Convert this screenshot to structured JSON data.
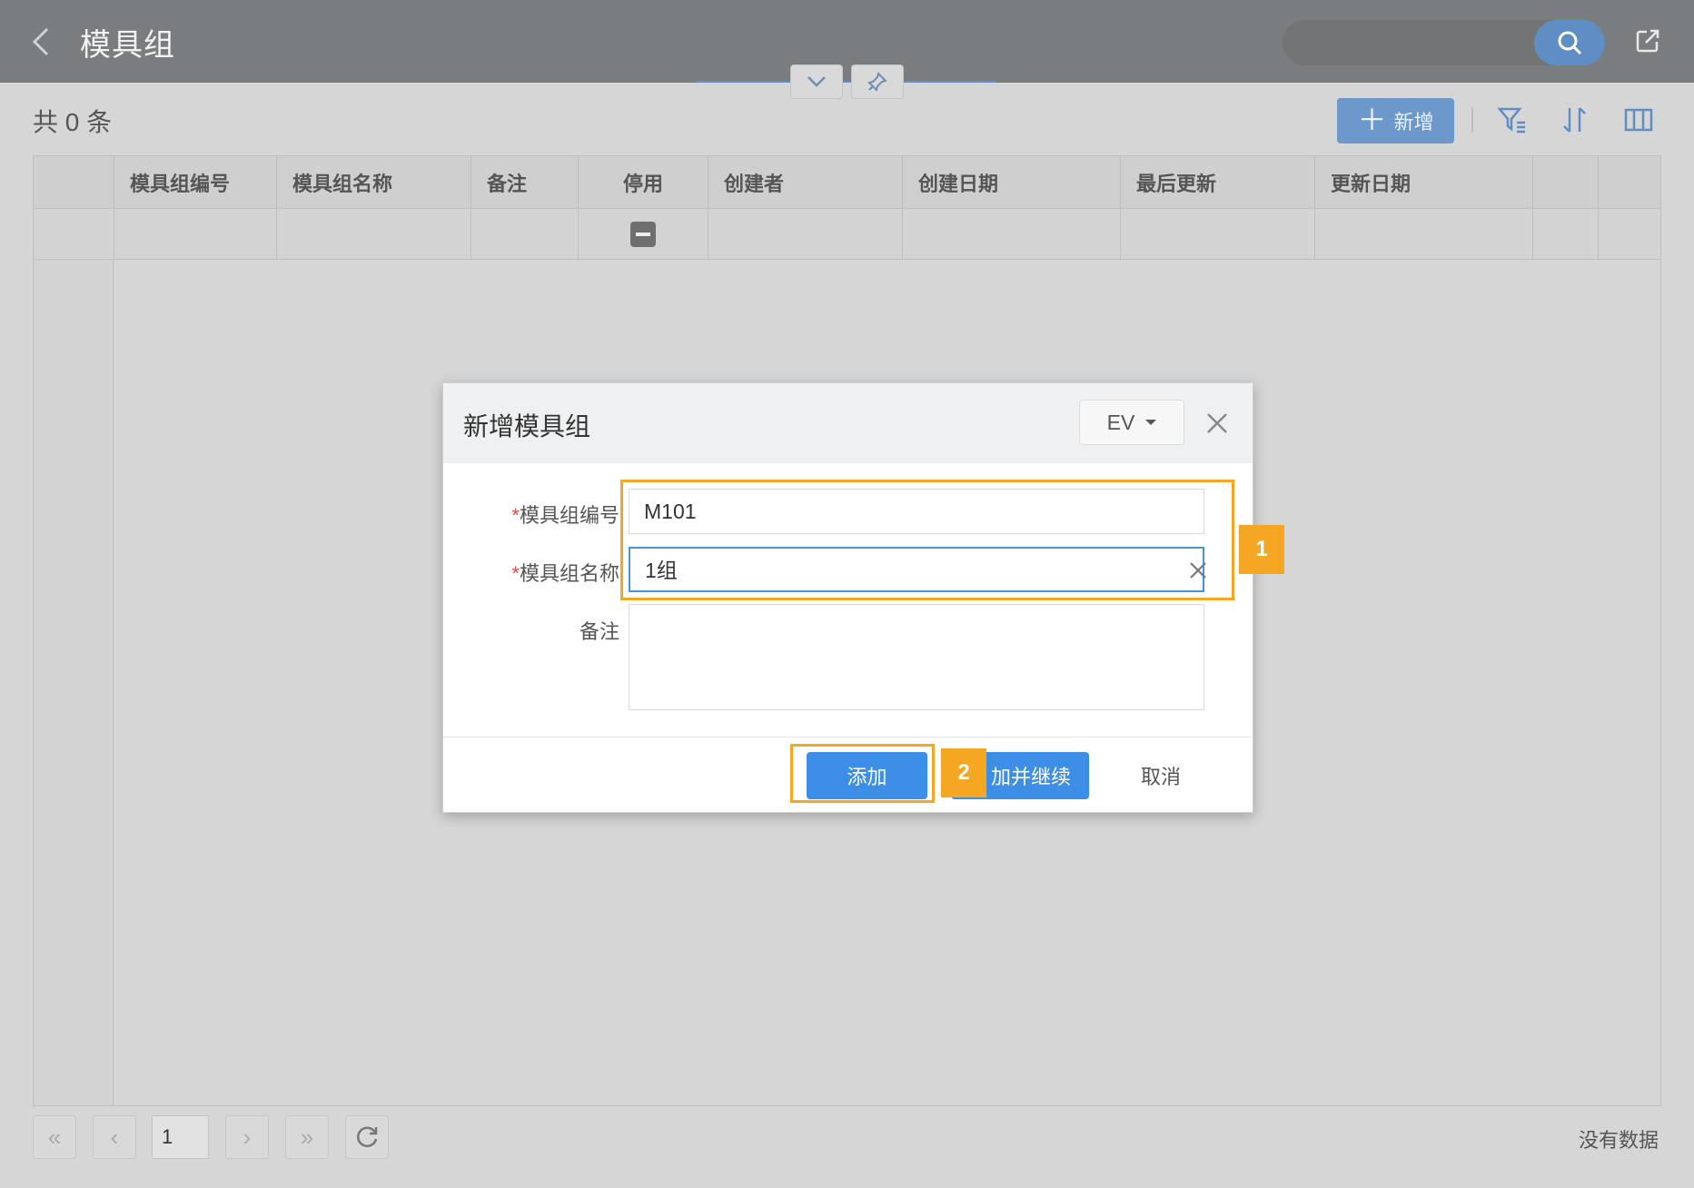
{
  "header": {
    "title": "模具组",
    "icons": {
      "back": "chevron-left-icon",
      "search": "search-icon",
      "share": "external-link-icon",
      "collapse": "chevron-down-icon",
      "pin": "pin-icon"
    }
  },
  "toolbar": {
    "count_text": "共 0 条",
    "add_label": "新增",
    "icons": {
      "filter": "filter-icon",
      "sort": "sort-icon",
      "columns": "columns-icon"
    }
  },
  "table": {
    "columns": [
      "模具组编号",
      "模具组名称",
      "备注",
      "停用",
      "创建者",
      "创建日期",
      "最后更新",
      "更新日期"
    ],
    "rows": []
  },
  "pager": {
    "page": "1",
    "status": "没有数据",
    "icons": {
      "first": "double-chevron-left-icon",
      "prev": "chevron-left-icon",
      "next": "chevron-right-icon",
      "last": "double-chevron-right-icon",
      "refresh": "refresh-icon"
    }
  },
  "dialog": {
    "title": "新增模具组",
    "language": "EV",
    "fields": {
      "code": {
        "required_mark": "*",
        "label": "模具组编号",
        "value": "M101"
      },
      "name": {
        "required_mark": "*",
        "label": "模具组名称",
        "value": "1组"
      },
      "remark": {
        "label": "备注",
        "value": ""
      }
    },
    "buttons": {
      "add": "添加",
      "add_continue": "加并继续",
      "cancel": "取消"
    }
  },
  "annotations": {
    "badge_1": "1",
    "badge_2": "2",
    "color": "#f5a623"
  },
  "colors": {
    "primary": "#3d8ee6",
    "header": "#7a7d80",
    "highlight": "#f5a623"
  }
}
